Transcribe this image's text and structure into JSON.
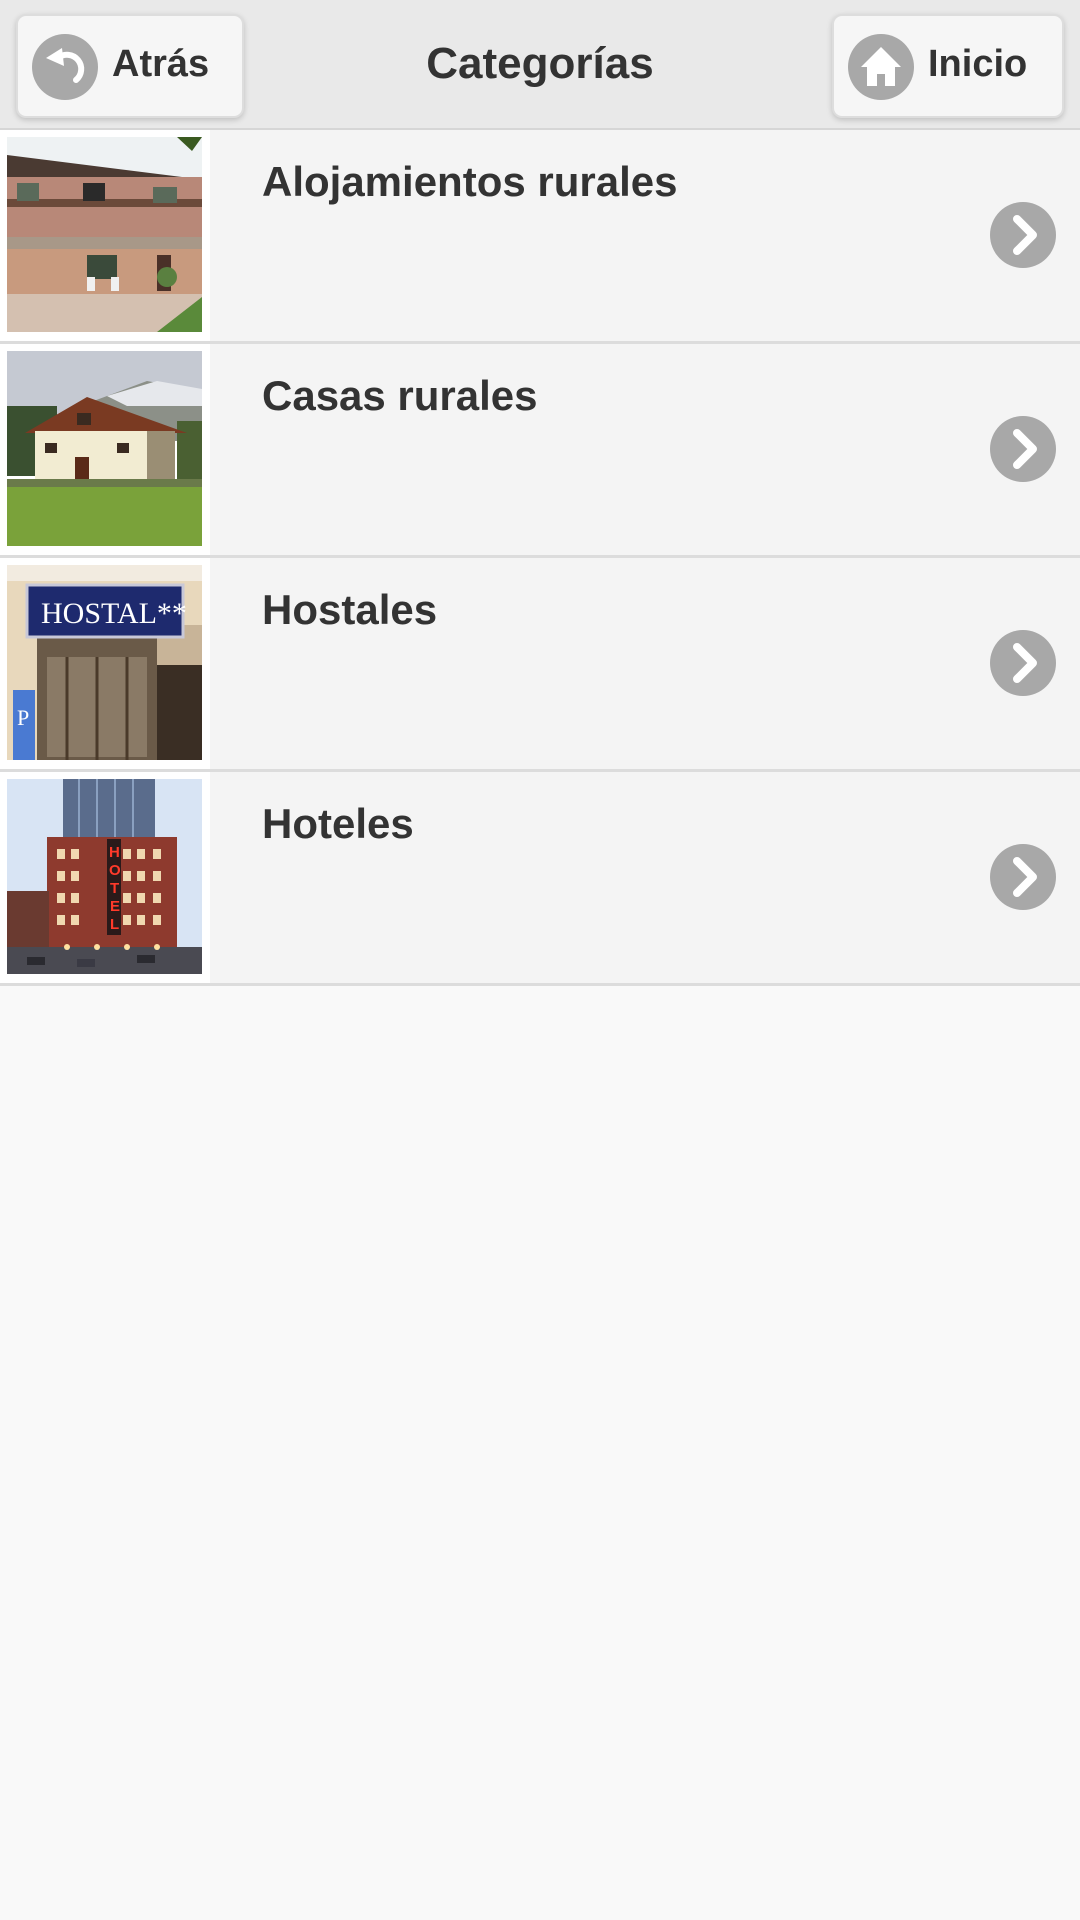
{
  "header": {
    "title": "Categorías",
    "back_label": "Atrás",
    "home_label": "Inicio"
  },
  "categories": [
    {
      "label": "Alojamientos rurales",
      "image": "rural-lodging-photo"
    },
    {
      "label": "Casas rurales",
      "image": "country-house-photo"
    },
    {
      "label": "Hostales",
      "image": "hostal-sign-photo",
      "sign_text": "HOSTAL**"
    },
    {
      "label": "Hoteles",
      "image": "hotel-building-photo",
      "sign_text": "HOTEL"
    }
  ],
  "colors": {
    "header_bg": "#e9e9e9",
    "row_bg": "#f4f4f4",
    "icon_gray": "#a8a8a8",
    "text": "#333333"
  }
}
